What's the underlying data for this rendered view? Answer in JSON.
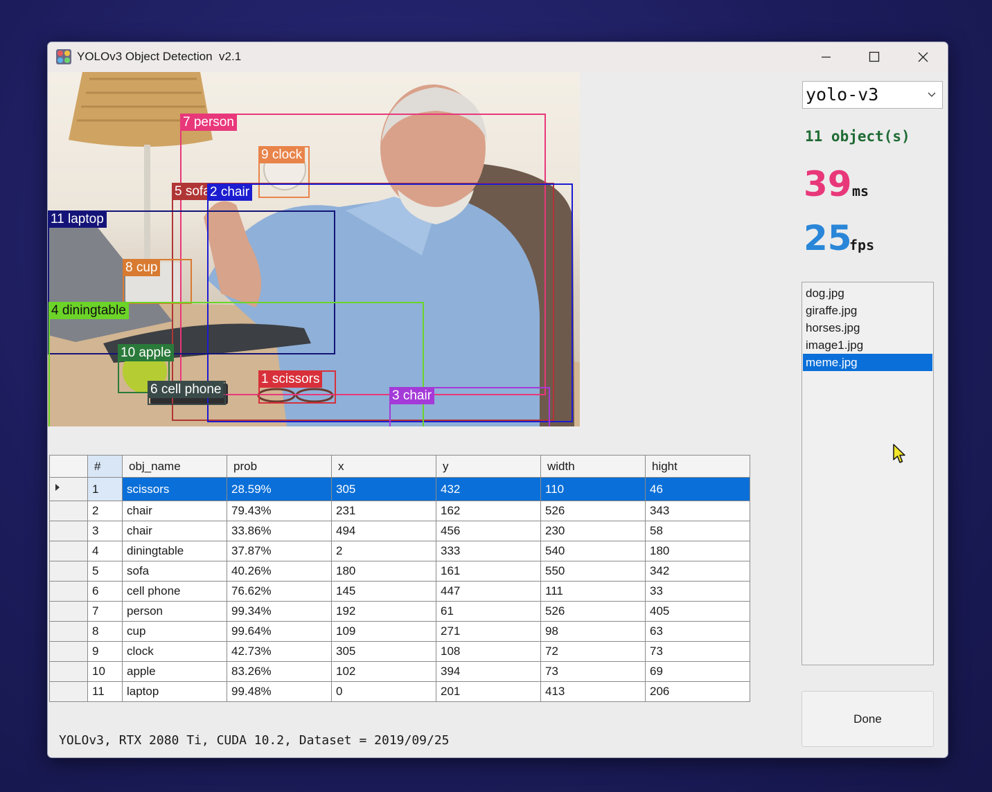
{
  "window": {
    "title": "YOLOv3 Object Detection  v2.1",
    "controls": [
      "minimize",
      "maximize",
      "close"
    ]
  },
  "detections": [
    {
      "label": "7 person",
      "color": "#e8387a"
    },
    {
      "label": "9 clock",
      "color": "#e8844a"
    },
    {
      "label": "5 sofa",
      "color": "#b03636"
    },
    {
      "label": "2 chair",
      "color": "#1c1cd0"
    },
    {
      "label": "11 laptop",
      "color": "#141478"
    },
    {
      "label": "8 cup",
      "color": "#d87a30"
    },
    {
      "label": "4 diningtable",
      "color": "#6cd428"
    },
    {
      "label": "10 apple",
      "color": "#2a7a3a"
    },
    {
      "label": "6 cell phone",
      "color": "#3a4a48"
    },
    {
      "label": "1 scissors",
      "color": "#d8303a"
    },
    {
      "label": "3 chair",
      "color": "#a43ad8"
    }
  ],
  "table": {
    "columns": [
      "#",
      "obj_name",
      "prob",
      "x",
      "y",
      "width",
      "hight"
    ],
    "selected_row": 0,
    "rows": [
      [
        "1",
        "scissors",
        "28.59%",
        "305",
        "432",
        "110",
        "46"
      ],
      [
        "2",
        "chair",
        "79.43%",
        "231",
        "162",
        "526",
        "343"
      ],
      [
        "3",
        "chair",
        "33.86%",
        "494",
        "456",
        "230",
        "58"
      ],
      [
        "4",
        "diningtable",
        "37.87%",
        "2",
        "333",
        "540",
        "180"
      ],
      [
        "5",
        "sofa",
        "40.26%",
        "180",
        "161",
        "550",
        "342"
      ],
      [
        "6",
        "cell phone",
        "76.62%",
        "145",
        "447",
        "111",
        "33"
      ],
      [
        "7",
        "person",
        "99.34%",
        "192",
        "61",
        "526",
        "405"
      ],
      [
        "8",
        "cup",
        "99.64%",
        "109",
        "271",
        "98",
        "63"
      ],
      [
        "9",
        "clock",
        "42.73%",
        "305",
        "108",
        "72",
        "73"
      ],
      [
        "10",
        "apple",
        "83.26%",
        "102",
        "394",
        "73",
        "69"
      ],
      [
        "11",
        "laptop",
        "99.48%",
        "0",
        "201",
        "413",
        "206"
      ]
    ]
  },
  "status_text": "YOLOv3, RTX 2080 Ti, CUDA 10.2, Dataset = 2019/09/25",
  "model": {
    "selected": "yolo-v3"
  },
  "stats": {
    "objects": "11 object(s)",
    "ms_value": "39",
    "ms_unit": "ms",
    "ms_color": "#e8387a",
    "fps_value": "25",
    "fps_unit": "fps",
    "fps_color": "#2a86d8"
  },
  "files": {
    "items": [
      "dog.jpg",
      "giraffe.jpg",
      "horses.jpg",
      "image1.jpg",
      "meme.jpg"
    ],
    "selected": 4
  },
  "done_button": "Done",
  "icons": [
    "app-icon",
    "minimize-icon",
    "maximize-icon",
    "close-icon",
    "chevron-down-icon",
    "row-pointer-icon",
    "mouse-cursor-icon"
  ]
}
